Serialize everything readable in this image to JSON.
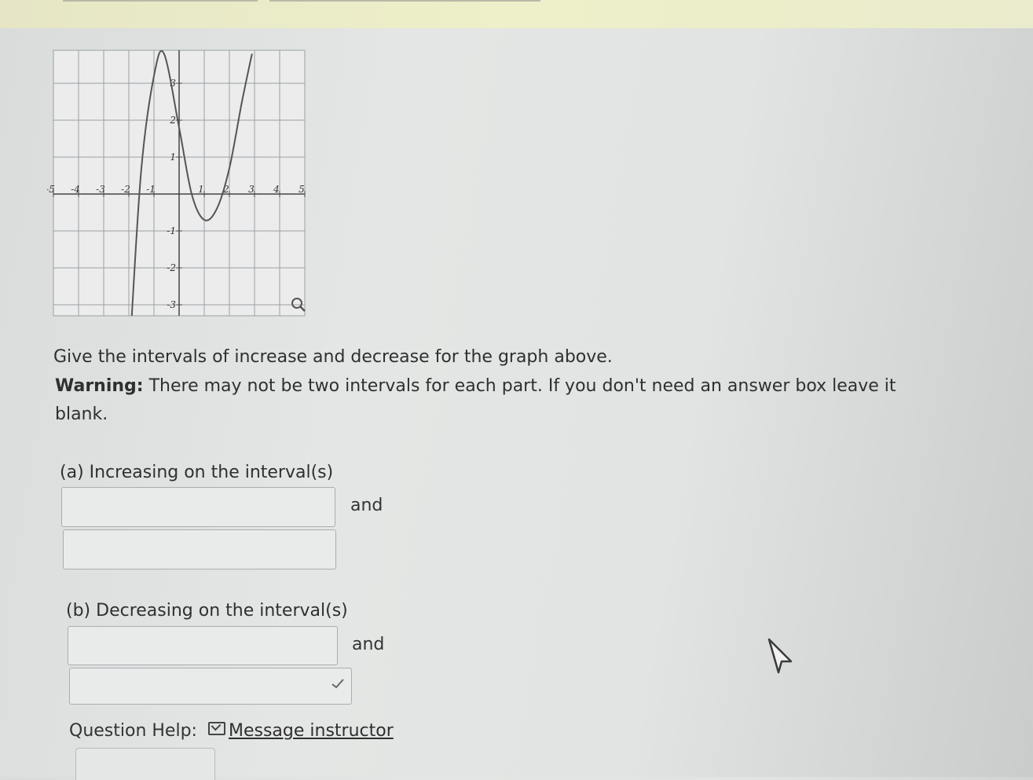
{
  "graph": {
    "x_ticks": [
      "-5",
      "-4",
      "-3",
      "-2",
      "-1",
      "1",
      "2",
      "3",
      "4",
      "5"
    ],
    "y_ticks": [
      "3",
      "2",
      "1",
      "-1",
      "-2",
      "-3"
    ],
    "x_range": [
      -5,
      5
    ],
    "y_range": [
      -3.5,
      3.5
    ],
    "curve_color": "#555555",
    "grid_color": "#9aa0a3"
  },
  "question": {
    "prompt": "Give the intervals of increase and decrease for the graph above.",
    "warning_label": "Warning:",
    "warning_text": " There may not be two intervals for each part. If you don't need an answer box leave it blank."
  },
  "part_a": {
    "label": "(a) Increasing on the interval(s)",
    "and_label": "and"
  },
  "part_b": {
    "label": "(b) Decreasing on the interval(s)",
    "and_label": "and"
  },
  "help": {
    "label": "Question Help:",
    "link": "Message instructor"
  },
  "icons": {
    "magnify": "magnify-icon",
    "mail": "mail-icon",
    "check": "check-icon",
    "cursor": "cursor-icon"
  }
}
